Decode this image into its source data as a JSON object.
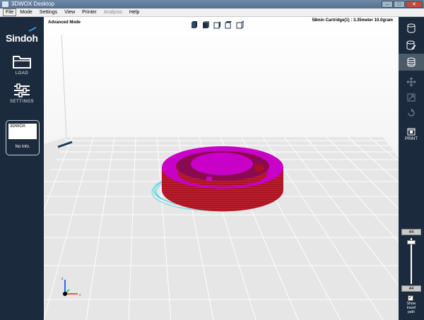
{
  "window": {
    "title": "3DWOX Desktop",
    "minimize": "–",
    "maximize": "□",
    "close": "✕"
  },
  "menu": {
    "items": [
      "File",
      "Mode",
      "Settings",
      "View",
      "Printer",
      "Analysis",
      "Help"
    ],
    "disabled": [
      "Analysis"
    ]
  },
  "left_panel": {
    "logo": "Sindoh",
    "load_label": "LOAD",
    "settings_label": "SETTINGS",
    "printer_name": "3DWOX",
    "printer_info": "No Info."
  },
  "viewport": {
    "mode_label": "Advanced Mode",
    "stats": "58min  Cartridge(1) : 3.35meter 10.0gram",
    "view_buttons": [
      "view-3d-icon",
      "view-front-icon",
      "view-side-icon",
      "view-top-icon",
      "view-right-icon"
    ]
  },
  "right_panel": {
    "print_label": "PRINT",
    "layer_top": "44",
    "layer_bottom": "44",
    "slider_position": 0.05,
    "show_travel_checked": true,
    "check_glyph": "✓",
    "show_travel_label_line1": "Show",
    "show_travel_label_line2": "travel",
    "show_travel_label_line3": "path"
  },
  "colors": {
    "model_top": "#cc00cc",
    "model_side": "#aa1020",
    "travel_path": "#40d8e0",
    "grid_bg": "#e8e8e8",
    "panel": "#1b2a3c"
  }
}
